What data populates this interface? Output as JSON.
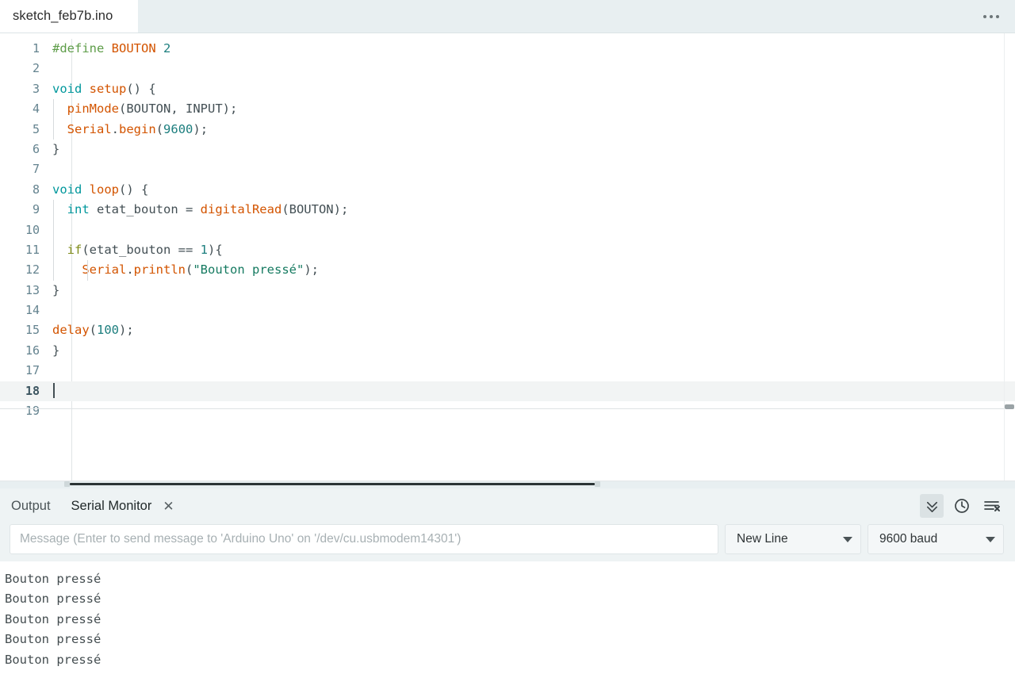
{
  "window": {
    "tab_title": "sketch_feb7b.ino",
    "overflow_menu": "…"
  },
  "editor": {
    "active_line": 18,
    "cursor_line": 18,
    "total_lines": 19,
    "language": "arduino",
    "colors": {
      "preprocessor": "#5e9d49",
      "constant": "#d35400",
      "number": "#1c7e7e",
      "type": "#00979c",
      "function": "#d35400",
      "keyword": "#7f8c1a",
      "string": "#157a60",
      "plain": "#434f54",
      "line_number": "#64838f",
      "active_line_bg": "#f2f4f4"
    },
    "lines": [
      {
        "n": 1,
        "indent": 0,
        "tokens": [
          {
            "t": "#define ",
            "c": "t-pre"
          },
          {
            "t": "BOUTON",
            "c": "t-const"
          },
          {
            "t": " ",
            "c": "t-plain"
          },
          {
            "t": "2",
            "c": "t-num"
          }
        ]
      },
      {
        "n": 2,
        "indent": 0,
        "tokens": []
      },
      {
        "n": 3,
        "indent": 0,
        "tokens": [
          {
            "t": "void ",
            "c": "t-type"
          },
          {
            "t": "setup",
            "c": "t-func"
          },
          {
            "t": "() {",
            "c": "t-plain"
          }
        ]
      },
      {
        "n": 4,
        "indent": 1,
        "tokens": [
          {
            "t": "  ",
            "c": "t-plain"
          },
          {
            "t": "pinMode",
            "c": "t-func"
          },
          {
            "t": "(BOUTON, INPUT);",
            "c": "t-plain"
          }
        ]
      },
      {
        "n": 5,
        "indent": 1,
        "tokens": [
          {
            "t": "  ",
            "c": "t-plain"
          },
          {
            "t": "Serial",
            "c": "t-func"
          },
          {
            "t": ".",
            "c": "t-plain"
          },
          {
            "t": "begin",
            "c": "t-func"
          },
          {
            "t": "(",
            "c": "t-plain"
          },
          {
            "t": "9600",
            "c": "t-num"
          },
          {
            "t": ");",
            "c": "t-plain"
          }
        ]
      },
      {
        "n": 6,
        "indent": 0,
        "tokens": [
          {
            "t": "}",
            "c": "t-plain"
          }
        ]
      },
      {
        "n": 7,
        "indent": 0,
        "tokens": []
      },
      {
        "n": 8,
        "indent": 0,
        "tokens": [
          {
            "t": "void ",
            "c": "t-type"
          },
          {
            "t": "loop",
            "c": "t-func"
          },
          {
            "t": "() {",
            "c": "t-plain"
          }
        ]
      },
      {
        "n": 9,
        "indent": 1,
        "tokens": [
          {
            "t": "  ",
            "c": "t-plain"
          },
          {
            "t": "int",
            "c": "t-type"
          },
          {
            "t": " etat_bouton = ",
            "c": "t-plain"
          },
          {
            "t": "digitalRead",
            "c": "t-func"
          },
          {
            "t": "(BOUTON);",
            "c": "t-plain"
          }
        ]
      },
      {
        "n": 10,
        "indent": 1,
        "tokens": []
      },
      {
        "n": 11,
        "indent": 1,
        "tokens": [
          {
            "t": "  ",
            "c": "t-plain"
          },
          {
            "t": "if",
            "c": "t-kw"
          },
          {
            "t": "(etat_bouton == ",
            "c": "t-plain"
          },
          {
            "t": "1",
            "c": "t-num"
          },
          {
            "t": "){",
            "c": "t-plain"
          }
        ]
      },
      {
        "n": 12,
        "indent": 2,
        "tokens": [
          {
            "t": "    ",
            "c": "t-plain"
          },
          {
            "t": "Serial",
            "c": "t-func"
          },
          {
            "t": ".",
            "c": "t-plain"
          },
          {
            "t": "println",
            "c": "t-func"
          },
          {
            "t": "(",
            "c": "t-plain"
          },
          {
            "t": "\"Bouton pressé\"",
            "c": "t-str"
          },
          {
            "t": ");",
            "c": "t-plain"
          }
        ]
      },
      {
        "n": 13,
        "indent": 0,
        "tokens": [
          {
            "t": "}",
            "c": "t-plain"
          }
        ]
      },
      {
        "n": 14,
        "indent": 0,
        "tokens": []
      },
      {
        "n": 15,
        "indent": 0,
        "tokens": [
          {
            "t": "delay",
            "c": "t-func"
          },
          {
            "t": "(",
            "c": "t-plain"
          },
          {
            "t": "100",
            "c": "t-num"
          },
          {
            "t": ");",
            "c": "t-plain"
          }
        ]
      },
      {
        "n": 16,
        "indent": 0,
        "tokens": [
          {
            "t": "}",
            "c": "t-plain"
          }
        ]
      },
      {
        "n": 17,
        "indent": 0,
        "tokens": []
      },
      {
        "n": 18,
        "indent": 0,
        "tokens": [],
        "active": true,
        "caret": true
      },
      {
        "n": 19,
        "indent": 0,
        "tokens": []
      }
    ]
  },
  "panel": {
    "tabs": [
      {
        "label": "Output",
        "active": false,
        "closable": false
      },
      {
        "label": "Serial Monitor",
        "active": true,
        "closable": true,
        "close_glyph": "✕"
      }
    ],
    "actions": [
      {
        "name": "autoscroll-button",
        "icon": "chevron-double-down-icon",
        "toggled": true
      },
      {
        "name": "timestamp-button",
        "icon": "clock-icon",
        "toggled": false
      },
      {
        "name": "clear-output-button",
        "icon": "clear-lines-icon",
        "toggled": false
      }
    ],
    "message": {
      "placeholder": "Message (Enter to send message to 'Arduino Uno' on '/dev/cu.usbmodem14301')",
      "value": ""
    },
    "line_ending": {
      "selected": "New Line"
    },
    "baud_rate": {
      "selected": "9600 baud"
    },
    "output_lines": [
      "Bouton pressé",
      "Bouton pressé",
      "Bouton pressé",
      "Bouton pressé",
      "Bouton pressé"
    ]
  }
}
